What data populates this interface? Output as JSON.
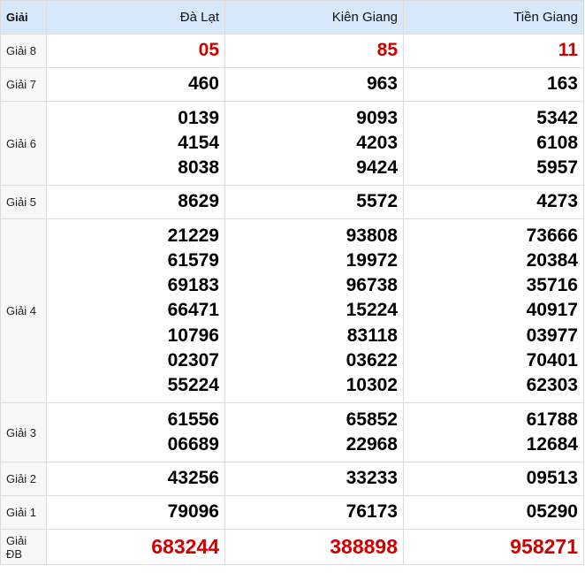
{
  "header": {
    "prize_label": "Giải",
    "provinces": [
      "Đà Lạt",
      "Kiên Giang",
      "Tiền Giang"
    ]
  },
  "colors": {
    "header_bg": "#d7e8fb",
    "highlight_red": "#cc0000",
    "label_bg": "#f7f7f7"
  },
  "rows": [
    {
      "label": "Giải 8",
      "red": true,
      "values": [
        [
          "05"
        ],
        [
          "85"
        ],
        [
          "11"
        ]
      ]
    },
    {
      "label": "Giải 7",
      "values": [
        [
          "460"
        ],
        [
          "963"
        ],
        [
          "163"
        ]
      ]
    },
    {
      "label": "Giải 6",
      "values": [
        [
          "0139",
          "4154",
          "8038"
        ],
        [
          "9093",
          "4203",
          "9424"
        ],
        [
          "5342",
          "6108",
          "5957"
        ]
      ]
    },
    {
      "label": "Giải 5",
      "values": [
        [
          "8629"
        ],
        [
          "5572"
        ],
        [
          "4273"
        ]
      ]
    },
    {
      "label": "Giải 4",
      "values": [
        [
          "21229",
          "61579",
          "69183",
          "66471",
          "10796",
          "02307",
          "55224"
        ],
        [
          "93808",
          "19972",
          "96738",
          "15224",
          "83118",
          "03622",
          "10302"
        ],
        [
          "73666",
          "20384",
          "35716",
          "40917",
          "03977",
          "70401",
          "62303"
        ]
      ]
    },
    {
      "label": "Giải 3",
      "values": [
        [
          "61556",
          "06689"
        ],
        [
          "65852",
          "22968"
        ],
        [
          "61788",
          "12684"
        ]
      ]
    },
    {
      "label": "Giải 2",
      "values": [
        [
          "43256"
        ],
        [
          "33233"
        ],
        [
          "09513"
        ]
      ]
    },
    {
      "label": "Giải 1",
      "values": [
        [
          "79096"
        ],
        [
          "76173"
        ],
        [
          "05290"
        ]
      ]
    },
    {
      "label": "Giải ĐB",
      "red": true,
      "special": true,
      "values": [
        [
          "683244"
        ],
        [
          "388898"
        ],
        [
          "958271"
        ]
      ]
    }
  ]
}
